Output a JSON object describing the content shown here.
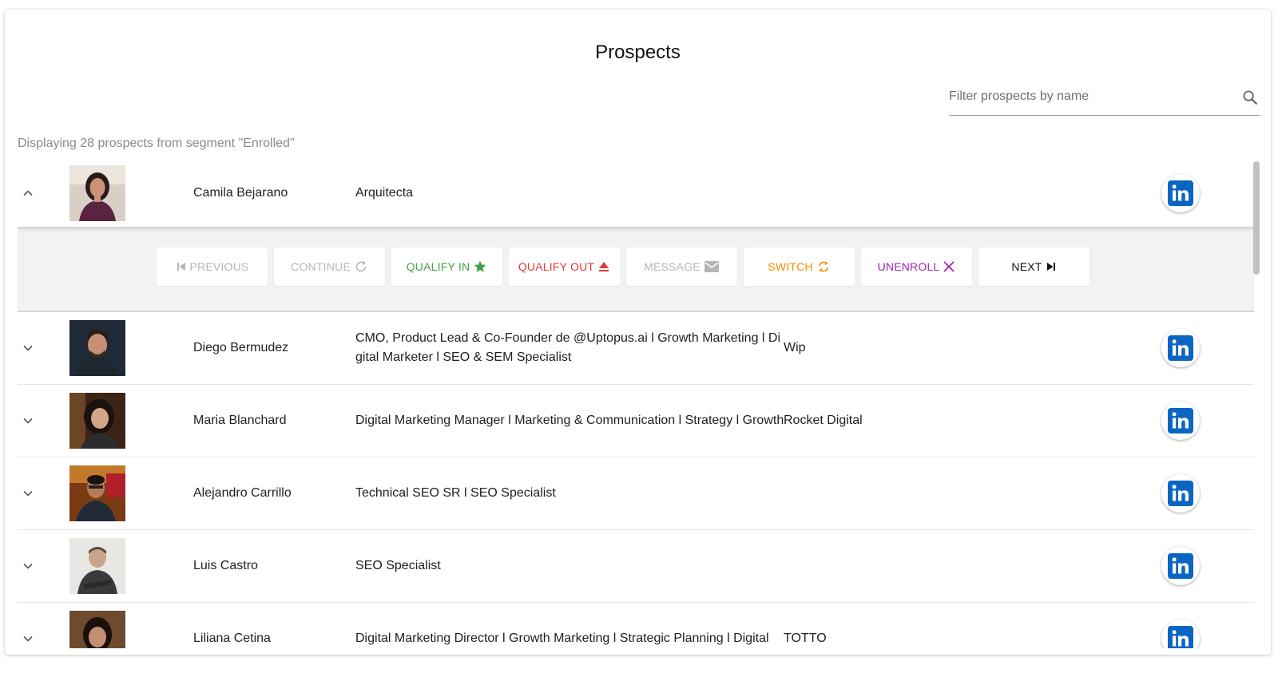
{
  "page": {
    "title": "Prospects"
  },
  "search": {
    "placeholder": "Filter prospects by name",
    "icon": "search-icon"
  },
  "info": "Displaying 28 prospects from segment \"Enrolled\"",
  "colors": {
    "green": "#43a047",
    "red": "#e53935",
    "orange": "#fb8c00",
    "purple": "#9c27b0",
    "disabled": "#b5b5b5",
    "linkedin": "#0a66c2"
  },
  "actions": {
    "previous": "PREVIOUS",
    "continue": "CONTINUE",
    "qualify_in": "QUALIFY IN",
    "qualify_out": "QUALIFY OUT",
    "message": "MESSAGE",
    "switch": "SWITCH",
    "unenroll": "UNENROLL",
    "next": "NEXT"
  },
  "prospects": [
    {
      "name": "Camila Bejarano",
      "headline": "Arquitecta",
      "company": ""
    },
    {
      "name": "Diego Bermudez",
      "headline": "CMO, Product Lead & Co-Founder de @Uptopus.ai l Growth Marketing l Digital Marketer l SEO & SEM Specialist",
      "company": "Wip"
    },
    {
      "name": "Maria Blanchard",
      "headline": "Digital Marketing Manager l Marketing & Communication l Strategy l Growth",
      "company": "Rocket Digital"
    },
    {
      "name": "Alejandro Carrillo",
      "headline": "Technical SEO SR l SEO Specialist",
      "company": ""
    },
    {
      "name": "Luis Castro",
      "headline": "SEO Specialist",
      "company": ""
    },
    {
      "name": "Liliana Cetina",
      "headline": "Digital Marketing Director l Growth Marketing l Strategic Planning l Digital",
      "company": "TOTTO"
    }
  ]
}
